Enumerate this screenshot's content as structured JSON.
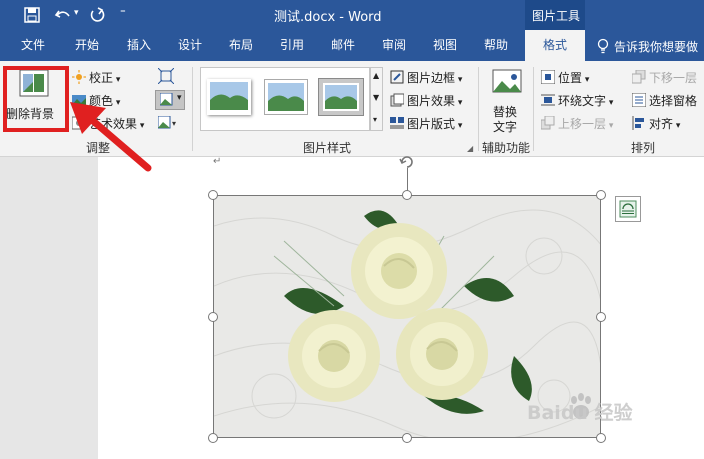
{
  "title_bar": {
    "doc_title": "测试.docx  -  Word",
    "context_label": "图片工具"
  },
  "tabs": [
    "文件",
    "开始",
    "插入",
    "设计",
    "布局",
    "引用",
    "邮件",
    "审阅",
    "视图",
    "帮助",
    "格式"
  ],
  "tell_me": "告诉我你想要做",
  "ribbon": {
    "remove_bg": "删除背景",
    "corrections": "校正",
    "color": "颜色",
    "artistic_effects": "艺术效果",
    "group_adjust": "调整",
    "picture_border": "图片边框",
    "picture_effects": "图片效果",
    "picture_layout": "图片版式",
    "group_styles": "图片样式",
    "alt_text_line1": "替换",
    "alt_text_line2": "文字",
    "group_accessibility": "辅助功能",
    "position": "位置",
    "wrap_text": "环绕文字",
    "bring_forward": "上移一层",
    "send_backward": "下移一层",
    "selection_pane": "选择窗格",
    "align": "对齐",
    "group_arrange": "排列"
  },
  "watermark": "Baidu 经验",
  "colors": {
    "accent": "#2b579a",
    "highlight_box": "#e02020"
  }
}
